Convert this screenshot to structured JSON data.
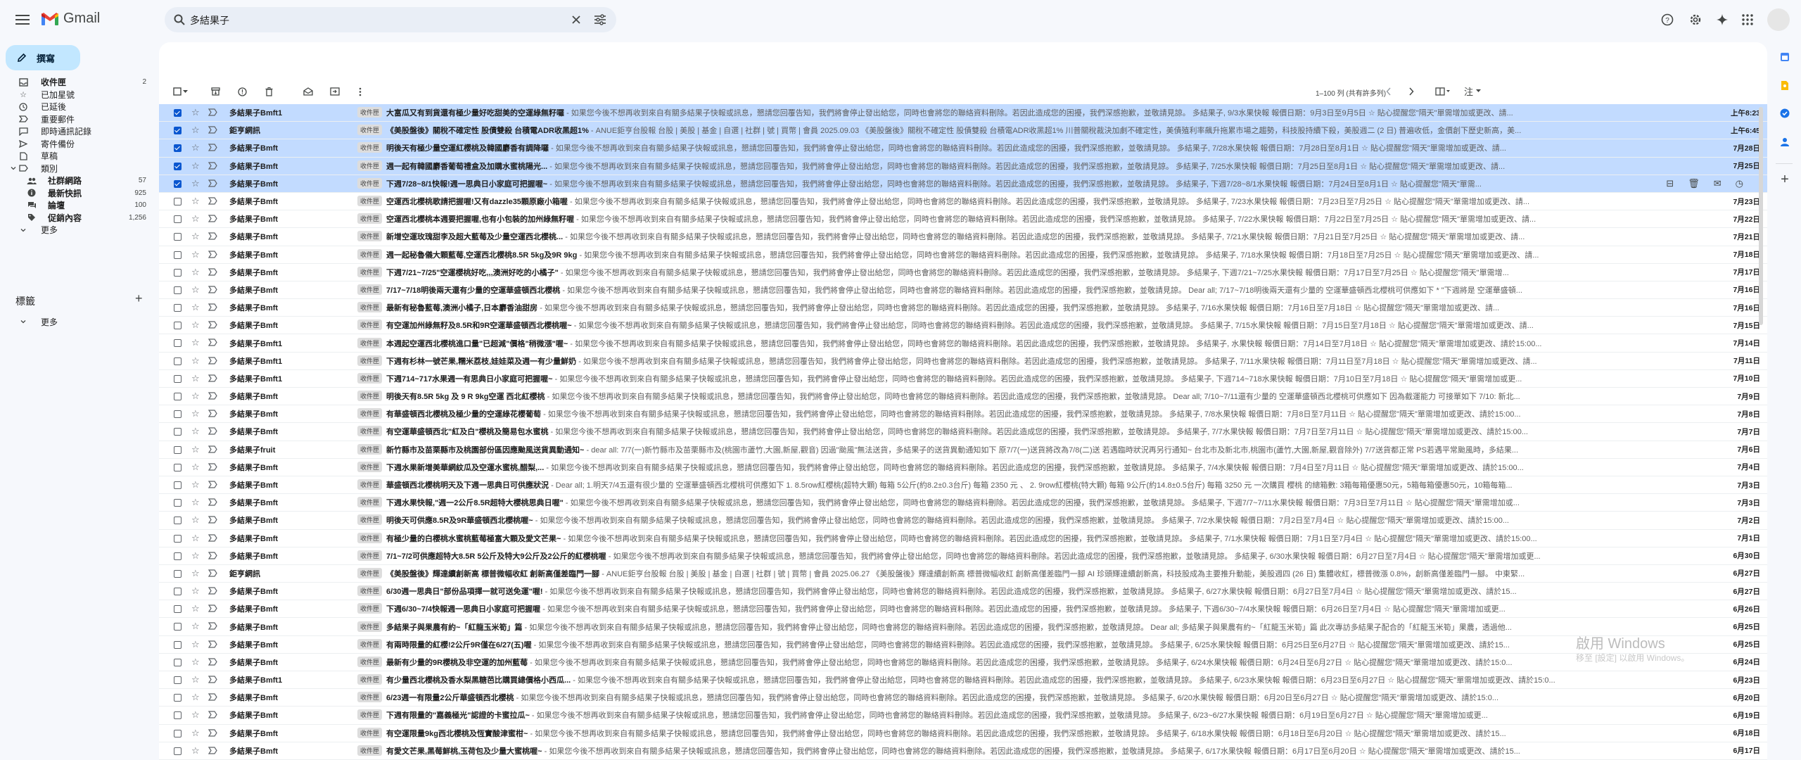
{
  "app": {
    "name": "Gmail",
    "brand_colors": [
      "#ea4335",
      "#4285f4",
      "#34a853",
      "#fbbc04"
    ]
  },
  "search": {
    "value": "多結果子"
  },
  "sidebar": {
    "compose_label": "撰寫",
    "items": [
      {
        "label": "收件匣",
        "count": "2",
        "icon": "inbox-icon"
      },
      {
        "label": "已加星號",
        "count": "",
        "icon": "star-icon"
      },
      {
        "label": "已延後",
        "count": "",
        "icon": "clock-icon"
      },
      {
        "label": "重要郵件",
        "count": "",
        "icon": "important-icon"
      },
      {
        "label": "即時通訊記錄",
        "count": "",
        "icon": "chat-icon"
      },
      {
        "label": "寄件備份",
        "count": "",
        "icon": "send-icon"
      },
      {
        "label": "草稿",
        "count": "",
        "icon": "draft-icon"
      },
      {
        "label": "類別",
        "count": "",
        "icon": "label-icon"
      }
    ],
    "categories": [
      {
        "label": "社群網路",
        "count": "57",
        "icon": "people-icon"
      },
      {
        "label": "最新快訊",
        "count": "925",
        "icon": "info-icon"
      },
      {
        "label": "論壇",
        "count": "100",
        "icon": "forum-icon"
      },
      {
        "label": "促銷內容",
        "count": "1,256",
        "icon": "tag-icon"
      }
    ],
    "more_label": "更多",
    "labels_title": "標籤",
    "labels_more": "更多"
  },
  "toolbar": {
    "pager": "1–100 列 (共有許多列)",
    "note_label": "注"
  },
  "emails": [
    {
      "sender": "多結果子Bmft1",
      "tag": "收件匣",
      "subject": "大富瓜又有到貨還有極少量好吃甜美的空運綠無籽囉",
      "snippet": " - 如果您今後不想再收到來自有關多結果子快報或訊息，懇請您回覆告知，我們將會停止發出給您，同時也會將您的聯絡資料刪除。若因此造成您的困擾，我們深感抱歉，並敬請見諒。 多結果子, 9/3水果快報 報價日期：9月3日至9月5日 ☆ 貼心提醒您\"隔天\"單需增加或更改、請...",
      "date": "上午8:23",
      "sel": true
    },
    {
      "sender": "鉅亨網訊",
      "tag": "收件匣",
      "subject": "《美股盤後》關稅不確定性 股債雙殺 台積電ADR收黑超1%",
      "snippet": " - ANUE鉅亨台股報 台股 | 美股 | 基金 | 自選 | 社群 | 號 | 買幣 | 會員 2025.09.03 《美股盤後》關稅不確定性 股債雙殺 台積電ADR收黑超1% 川普關稅裁決加劇不確定性，美債殖利率飆升拖累市場之趨勢，科技股持續下殺，美股週二 (2 日) 普遍收低，金價創下歷史新高，美...",
      "date": "上午6:45",
      "sel": true
    },
    {
      "sender": "多結果子Bmft",
      "tag": "收件匣",
      "subject": "明後天有極少量空運紅櫻桃及韓國麝香有調降囉",
      "snippet": " - 如果您今後不想再收到來自有關多結果子快報或訊息，懇請您回覆告知，我們將會停止發出給您，同時也會將您的聯絡資料刪除。若因此造成您的困擾，我們深感抱歉，並敬請見諒。 多結果子, 7/28水果快報 報價日期：7月28日至8月1日 ☆ 貼心提醒您\"隔天\"單需增加或更改、請...",
      "date": "7月28日",
      "sel": true
    },
    {
      "sender": "多結果子Bmft",
      "tag": "收件匣",
      "subject": "週一起有韓國麝香葡萄禮盒及加購水蜜桃陽光...",
      "snippet": " - 如果您今後不想再收到來自有關多結果子快報或訊息，懇請您回覆告知，我們將會停止發出給您，同時也會將您的聯絡資料刪除。若因此造成您的困擾，我們深感抱歉，並敬請見諒。 多結果子, 7/25水果快報 報價日期：7月25日至8月1日 ☆ 貼心提醒您\"隔天\"單需增加或更改、請...",
      "date": "7月25日",
      "sel": true
    },
    {
      "sender": "多結果子Bmft",
      "tag": "收件匣",
      "subject": "下週7/28~8/1快報!週一思典日小家庭可把握喔~",
      "snippet": " - 如果您今後不想再收到來自有關多結果子快報或訊息，懇請您回覆告知，我們將會停止發出給您，同時也會將您的聯絡資料刪除。若因此造成您的困擾，我們深感抱歉，並敬請見諒。 多結果子, 下週7/28~8/1水果快報 報價日期：7月24日至8月1日 ☆ 貼心提醒您\"隔天\"單需...",
      "date": "",
      "sel": true,
      "hover": true
    },
    {
      "sender": "多結果子Bmft",
      "tag": "收件匣",
      "subject": "空運西北櫻桃歌請把握喔!又有dazzle35顆原廠小箱喔",
      "snippet": " - 如果您今後不想再收到來自有關多結果子快報或訊息，懇請您回覆告知，我們將會停止發出給您，同時也會將您的聯絡資料刪除。若因此造成您的困擾，我們深感抱歉，並敬請見諒。 多結果子, 7/23水果快報 報價日期：7月23日至7月25日 ☆ 貼心提醒您\"隔天\"單需增加或更改、請...",
      "date": "7月23日"
    },
    {
      "sender": "多結果子Bmft",
      "tag": "收件匣",
      "subject": "空運西北櫻桃本週要把握喔,也有小包裝的加州綠無籽喔",
      "snippet": " - 如果您今後不想再收到來自有關多結果子快報或訊息，懇請您回覆告知，我們將會停止發出給您，同時也會將您的聯絡資料刪除。若因此造成您的困擾，我們深感抱歉，並敬請見諒。 多結果子, 7/22水果快報 報價日期：7月22日至7月25日 ☆ 貼心提醒您\"隔天\"單需增加或更改、請...",
      "date": "7月22日"
    },
    {
      "sender": "多結果子Bmft",
      "tag": "收件匣",
      "subject": "新增空運玫瑰甜李及超大藍莓及少量空運西北櫻桃...",
      "snippet": " - 如果您今後不想再收到來自有關多結果子快報或訊息，懇請您回覆告知，我們將會停止發出給您，同時也會將您的聯絡資料刪除。若因此造成您的困擾，我們深感抱歉，並敬請見諒。 多結果子, 7/21水果快報 報價日期：7月21日至7月25日 ☆ 貼心提醒您\"隔天\"單需增加或更改、請...",
      "date": "7月21日"
    },
    {
      "sender": "多結果子Bmft",
      "tag": "收件匣",
      "subject": "週一起秘魯儀大顆藍莓,空運西北櫻桃8.5R 5kg及9R 9kg",
      "snippet": " - 如果您今後不想再收到來自有關多結果子快報或訊息，懇請您回覆告知，我們將會停止發出給您，同時也會將您的聯絡資料刪除。若因此造成您的困擾，我們深感抱歉，並敬請見諒。 多結果子, 7/18水果快報 報價日期：7月18日至7月25日 ☆ 貼心提醒您\"隔天\"單需增加或更改、請...",
      "date": "7月18日"
    },
    {
      "sender": "多結果子Bmft",
      "tag": "收件匣",
      "subject": "下週7/21~7/25\"空運櫻桃好吃,,,澳洲好吃的小橘子\"",
      "snippet": " - 如果您今後不想再收到來自有關多結果子快報或訊息，懇請您回覆告知，我們將會停止發出給您，同時也會將您的聯絡資料刪除。若因此造成您的困擾，我們深感抱歉，並敬請見諒。 多結果子, 下週7/21~7/25水果快報 報價日期：7月17日至7月25日 ☆ 貼心提醒您\"隔天\"單需增...",
      "date": "7月17日"
    },
    {
      "sender": "多結果子Bmft",
      "tag": "收件匣",
      "subject": "7/17~7/18明後兩天還有少量的空運華盛頓西北櫻桃",
      "snippet": " - 如果您今後不想再收到來自有關多結果子快報或訊息，懇請您回覆告知，我們將會停止發出給您，同時也會將您的聯絡資料刪除。若因此造成您的困擾，我們深感抱歉，並敬請見諒。 Dear all; 7/17~7/18明後兩天還有少量的 空運華盛頓西北櫻桃可供應如下 * \"下週將是 空運華盛頓...",
      "date": "7月16日"
    },
    {
      "sender": "多結果子Bmft",
      "tag": "收件匣",
      "subject": "最新有秘魯藍莓,澳洲小橘子,日本麝香油甜房",
      "snippet": " - 如果您今後不想再收到來自有關多結果子快報或訊息，懇請您回覆告知，我們將會停止發出給您，同時也會將您的聯絡資料刪除。若因此造成您的困擾，我們深感抱歉，並敬請見諒。 多結果子, 7/16水果快報 報價日期：7月16日至7月18日 ☆ 貼心提醒您\"隔天\"單需增加或更改、請...",
      "date": "7月16日"
    },
    {
      "sender": "多結果子Bmft",
      "tag": "收件匣",
      "subject": "有空運加州綠無籽及8.5R和9R空運華盛頓西北櫻桃喔~",
      "snippet": " - 如果您今後不想再收到來自有關多結果子快報或訊息，懇請您回覆告知，我們將會停止發出給您，同時也會將您的聯絡資料刪除。若因此造成您的困擾，我們深感抱歉，並敬請見諒。 多結果子, 7/15水果快報 報價日期：7月15日至7月18日 ☆ 貼心提醒您\"隔天\"單需增加或更改、請...",
      "date": "7月15日"
    },
    {
      "sender": "多結果子Bmft1",
      "tag": "收件匣",
      "subject": "本週起空運西北櫻桃進口量\"已超減\"價格\"稍微漲\"喔~",
      "snippet": " - 如果您今後不想再收到來自有關多結果子快報或訊息，懇請您回覆告知，我們將會停止發出給您，同時也會將您的聯絡資料刪除。若因此造成您的困擾，我們深感抱歉，並敬請見諒。 多結果子, 水果快報 報價日期：7月14日至7月18日 ☆ 貼心提醒您\"隔天\"單需增加或更改、請於15:00...",
      "date": "7月14日"
    },
    {
      "sender": "多結果子Bmft1",
      "tag": "收件匣",
      "subject": "下週有杉林一號芒果,糯米荔枝,娃娃菜及週一有少量鮮奶",
      "snippet": " - 如果您今後不想再收到來自有關多結果子快報或訊息，懇請您回覆告知，我們將會停止發出給您，同時也會將您的聯絡資料刪除。若因此造成您的困擾，我們深感抱歉，並敬請見諒。 多結果子, 7/11水果快報 報價日期：7月11日至7月18日 ☆ 貼心提醒您\"隔天\"單需增加或更改、請...",
      "date": "7月11日"
    },
    {
      "sender": "多結果子Bmft1",
      "tag": "收件匣",
      "subject": "下週714~717水果週一有思典日小家庭可把握喔~",
      "snippet": " - 如果您今後不想再收到來自有關多結果子快報或訊息，懇請您回覆告知，我們將會停止發出給您，同時也會將您的聯絡資料刪除。若因此造成您的困擾，我們深感抱歉，並敬請見諒。 多結果子, 下週714~718水果快報 報價日期：7月10日至7月18日 ☆ 貼心提醒您\"隔天\"單需增加或更...",
      "date": "7月10日"
    },
    {
      "sender": "多結果子Bmft",
      "tag": "收件匣",
      "subject": "明後天有8.5R 5kg 及 9 R 9kg空運 西北紅櫻桃",
      "snippet": " - 如果您今後不想再收到來自有關多結果子快報或訊息，懇請您回覆告知，我們將會停止發出給您，同時也會將您的聯絡資料刪除。若因此造成您的困擾，我們深感抱歉，並敬請見諒。 Dear all; 7/10~7/11還有少量的 空運華盛頓西北櫻桃可供應如下 因為截運能力 可接單如下 7/10: 新北...",
      "date": "7月9日"
    },
    {
      "sender": "多結果子Bmft",
      "tag": "收件匣",
      "subject": "有華盛頓西北櫻桃及極少量的空運綠花櫻葡萄",
      "snippet": " - 如果您今後不想再收到來自有關多結果子快報或訊息，懇請您回覆告知，我們將會停止發出給您，同時也會將您的聯絡資料刪除。若因此造成您的困擾，我們深感抱歉，並敬請見諒。 多結果子, 7/8水果快報 報價日期：7月8日至7月11日 ☆ 貼心提醒您\"隔天\"單需增加或更改、請於15:00...",
      "date": "7月8日"
    },
    {
      "sender": "多結果子Bmft",
      "tag": "收件匣",
      "subject": "有空運華盛頓西北\"紅及白\"櫻桃及簡易包水蜜桃",
      "snippet": " - 如果您今後不想再收到來自有關多結果子快報或訊息，懇請您回覆告知，我們將會停止發出給您，同時也會將您的聯絡資料刪除。若因此造成您的困擾，我們深感抱歉，並敬請見諒。 多結果子, 7/7水果快報 報價日期：7月7日至7月11日 ☆ 貼心提醒您\"隔天\"單需增加或更改、請於15:00...",
      "date": "7月7日"
    },
    {
      "sender": "多結果子fruit",
      "tag": "收件匣",
      "subject": "新竹縣市及苗栗縣市及桃園部份區因應颱風送貨異動通知~",
      "snippet": " - dear all: 7/7(一)新竹縣市及苗栗縣市及(桃園市蘆竹,大園,新屋,觀音) 因過\"颱風\"無法送貨，多結果子的送貨異動通知如下 原7/7(一)送貨將改為7/8(二)送 若遇臨時狀況再另行通知~ 台北市及新北市,桃園市(蘆竹,大園,新屋,觀音除外) 7/7送貨都正常 PS若遇平常颱風時，多結果...",
      "date": "7月6日"
    },
    {
      "sender": "多結果子Bmft",
      "tag": "收件匣",
      "subject": "下週水果新增美華網紋瓜及空運水蜜桃,醋梨,...",
      "snippet": " - 如果您今後不想再收到來自有關多結果子快報或訊息，懇請您回覆告知，我們將會停止發出給您，同時也會將您的聯絡資料刪除。若因此造成您的困擾，我們深感抱歉，並敬請見諒。 多結果子, 7/4水果快報 報價日期：7月4日至7月11日 ☆ 貼心提醒您\"隔天\"單需增加或更改、請於15:00...",
      "date": "7月4日"
    },
    {
      "sender": "多結果子Bmft",
      "tag": "收件匣",
      "subject": "華盛頓西北櫻桃明天及下週一思典日可供應狀況",
      "snippet": " - Dear all; 1.明天7/4五還有很少量的 空運華盛頓西北櫻桃可供應如下 1. 8.5row紅櫻桃(超特大顆) 每箱 5公斤(約8.2±0.3台斤) 每箱 2350 元 、 2. 9row紅櫻桃(特大顆) 每箱 9公斤(約14.8±0.5台斤) 每箱 3250 元 一次購買 櫻桃 的總箱數: 3箱每箱優惠50元，5箱每箱優惠50元，10箱每箱...",
      "date": "7月3日"
    },
    {
      "sender": "多結果子Bmft",
      "tag": "收件匣",
      "subject": "下週水果快報,\"週一2公斤8.5R超特大櫻桃思典日喔\"",
      "snippet": " - 如果您今後不想再收到來自有關多結果子快報或訊息，懇請您回覆告知，我們將會停止發出給您，同時也會將您的聯絡資料刪除。若因此造成您的困擾，我們深感抱歉，並敬請見諒。 多結果子, 下週7/7~7/11水果快報 報價日期：7月3日至7月11日 ☆ 貼心提醒您\"隔天\"單需增加或...",
      "date": "7月3日"
    },
    {
      "sender": "多結果子Bmft",
      "tag": "收件匣",
      "subject": "明後天可供應8.5R及9R華盛頓西北櫻桃喔~",
      "snippet": " - 如果您今後不想再收到來自有關多結果子快報或訊息，懇請您回覆告知，我們將會停止發出給您，同時也會將您的聯絡資料刪除。若因此造成您的困擾，我們深感抱歉，並敬請見諒。 多結果子, 7/2水果快報 報價日期：7月2日至7月4日 ☆ 貼心提醒您\"隔天\"單需增加或更改、請於15:00...",
      "date": "7月2日"
    },
    {
      "sender": "多結果子Bmft",
      "tag": "收件匣",
      "subject": "有極少量的白櫻桃水蜜桃藍莓極富大顆及愛文芒果~",
      "snippet": " - 如果您今後不想再收到來自有關多結果子快報或訊息，懇請您回覆告知，我們將會停止發出給您，同時也會將您的聯絡資料刪除。若因此造成您的困擾，我們深感抱歉，並敬請見諒。 多結果子, 7/1水果快報 報價日期：7月1日至7月4日 ☆ 貼心提醒您\"隔天\"單需增加或更改、請於15:00...",
      "date": "7月1日"
    },
    {
      "sender": "多結果子Bmft",
      "tag": "收件匣",
      "subject": "7/1~7/2可供應超特大8.5R 5公斤及特大9公斤及2公斤的紅櫻桃喔",
      "snippet": " - 如果您今後不想再收到來自有關多結果子快報或訊息，懇請您回覆告知，我們將會停止發出給您，同時也會將您的聯絡資料刪除。若因此造成您的困擾，我們深感抱歉，並敬請見諒。 多結果子, 6/30水果快報 報價日期：6月27日至7月4日 ☆ 貼心提醒您\"隔天\"單需增加或更...",
      "date": "6月30日"
    },
    {
      "sender": "鉅亨網訊",
      "tag": "收件匣",
      "subject": "《美股盤後》輝達續創新高 標普微幅收紅 創新高僅差臨門一腳",
      "snippet": " - ANUE鉅亨台股報 台股 | 美股 | 基金 | 自選 | 社群 | 號 | 買幣 | 會員 2025.06.27 《美股盤後》輝達續創新高 標普微幅收紅 創新高僅差臨門一腳 AI 珍頭輝達續創新高，科技股成為主要推升動能，美股週四 (26 日) 集體收紅，標普微漲 0.8%，創新高僅差臨門一腳。 中東緊...",
      "date": "6月27日"
    },
    {
      "sender": "多結果子Bmft",
      "tag": "收件匣",
      "subject": "6/30週一思典日\"部份品項擇一就可送免運\"喔!",
      "snippet": " - 如果您今後不想再收到來自有關多結果子快報或訊息，懇請您回覆告知，我們將會停止發出給您，同時也會將您的聯絡資料刪除。若因此造成您的困擾，我們深感抱歉，並敬請見諒。 多結果子, 6/27水果快報 報價日期：6月27日至7月4日 ☆ 貼心提醒您\"隔天\"單需增加或更改、請於15...",
      "date": "6月27日"
    },
    {
      "sender": "多結果子Bmft",
      "tag": "收件匣",
      "subject": "下週6/30~7/4快報週一思典日小家庭可把握喔",
      "snippet": " - 如果您今後不想再收到來自有關多結果子快報或訊息，懇請您回覆告知，我們將會停止發出給您，同時也會將您的聯絡資料刪除。若因此造成您的困擾，我們深感抱歉，並敬請見諒。 多結果子, 下週6/30~7/4水果快報 報價日期：6月26日至7月4日 ☆ 貼心提醒您\"隔天\"單需增加或更...",
      "date": "6月26日"
    },
    {
      "sender": "多結果子Bmft",
      "tag": "收件匣",
      "subject": "多結果子與果農有約~「紅龍玉米筍」篇",
      "snippet": " - 如果您今後不想再收到來自有關多結果子快報或訊息，懇請您回覆告知，我們將會停止發出給您，同時也會將您的聯絡資料刪除。若因此造成您的困擾，我們深感抱歉，並敬請見諒。 Dear all; 多結果子與果農有約~「紅龍玉米筍」篇 此次專訪多結果子配合的「紅龍玉米筍」果農，透過他...",
      "date": "6月25日"
    },
    {
      "sender": "多結果子Bmft",
      "tag": "收件匣",
      "subject": "有兩時限量的紅櫻!2公斤9R僅在6/27(五)喔",
      "snippet": " - 如果您今後不想再收到來自有關多結果子快報或訊息，懇請您回覆告知，我們將會停止發出給您，同時也會將您的聯絡資料刪除。若因此造成您的困擾，我們深感抱歉，並敬請見諒。 多結果子, 6/25水果快報 報價日期：6月25日至6月27日 ☆ 貼心提醒您\"隔天\"單需增加或更改、請於15...",
      "date": "6月25日"
    },
    {
      "sender": "多結果子Bmft",
      "tag": "收件匣",
      "subject": "最新有少量的9R櫻桃及非空運的加州藍莓",
      "snippet": " - 如果您今後不想再收到來自有關多結果子快報或訊息，懇請您回覆告知，我們將會停止發出給您，同時也會將您的聯絡資料刪除。若因此造成您的困擾，我們深感抱歉，並敬請見諒。 多結果子, 6/24水果快報 報價日期：6月24日至6月27日 ☆ 貼心提醒您\"隔天\"單需增加或更改、請於15:0...",
      "date": "6月24日"
    },
    {
      "sender": "多結果子Bmft1",
      "tag": "收件匣",
      "subject": "有少量西北櫻桃及香水梨黑糖芭比購買總價格小西瓜...",
      "snippet": " - 如果您今後不想再收到來自有關多結果子快報或訊息，懇請您回覆告知，我們將會停止發出給您，同時也會將您的聯絡資料刪除。若因此造成您的困擾，我們深感抱歉，並敬請見諒。 多結果子, 6/23水果快報 報價日期：6月23日至6月27日 ☆ 貼心提醒您\"隔天\"單需增加或更改、請於15:0...",
      "date": "6月23日"
    },
    {
      "sender": "多結果子Bmft",
      "tag": "收件匣",
      "subject": "6/23週一有限量2公斤華盛頓西北櫻桃",
      "snippet": " - 如果您今後不想再收到來自有關多結果子快報或訊息，懇請您回覆告知，我們將會停止發出給您，同時也會將您的聯絡資料刪除。若因此造成您的困擾，我們深感抱歉，並敬請見諒。 多結果子, 6/20水果快報 報價日期：6月20日至6月27日 ☆ 貼心提醒您\"隔天\"單需增加或更改、請於15:0...",
      "date": "6月20日"
    },
    {
      "sender": "多結果子Bmft",
      "tag": "收件匣",
      "subject": "下週有限量的\"嘉義極光\"認證的卡蜜拉瓜~",
      "snippet": " - 如果您今後不想再收到來自有關多結果子快報或訊息，懇請您回覆告知，我們將會停止發出給您，同時也會將您的聯絡資料刪除。若因此造成您的困擾，我們深感抱歉，並敬請見諒。 多結果子, 6/23~6/27水果快報 報價日期：6月19日至6月27日 ☆ 貼心提醒您\"隔天\"單需增加或更...",
      "date": "6月19日"
    },
    {
      "sender": "多結果子Bmft",
      "tag": "收件匣",
      "subject": "有空運限量9kg西北櫻桃及恆實酸津蜜柑~",
      "snippet": " - 如果您今後不想再收到來自有關多結果子快報或訊息，懇請您回覆告知，我們將會停止發出給您，同時也會將您的聯絡資料刪除。若因此造成您的困擾，我們深感抱歉，並敬請見諒。 多結果子, 6/18水果快報 報價日期：6月18日至6月20日 ☆ 貼心提醒您\"隔天\"單需增加或更改、請於15...",
      "date": "6月18日"
    },
    {
      "sender": "多結果子Bmft",
      "tag": "收件匣",
      "subject": "有愛文芒果,黑莓鮮桃,玉荷包及少量大蜜桃喔~",
      "snippet": " - 如果您今後不想再收到來自有關多結果子快報或訊息，懇請您回覆告知，我們將會停止發出給您，同時也會將您的聯絡資料刪除。若因此造成您的困擾，我們深感抱歉，並敬請見諒。 多結果子, 6/17水果快報 報價日期：6月17日至6月20日 ☆ 貼心提醒您\"隔天\"單需增加或更改、請於15...",
      "date": "6月17日"
    }
  ],
  "watermark": {
    "line1": "啟用 Windows",
    "line2": "移至 [設定] 以啟用 Windows。"
  }
}
